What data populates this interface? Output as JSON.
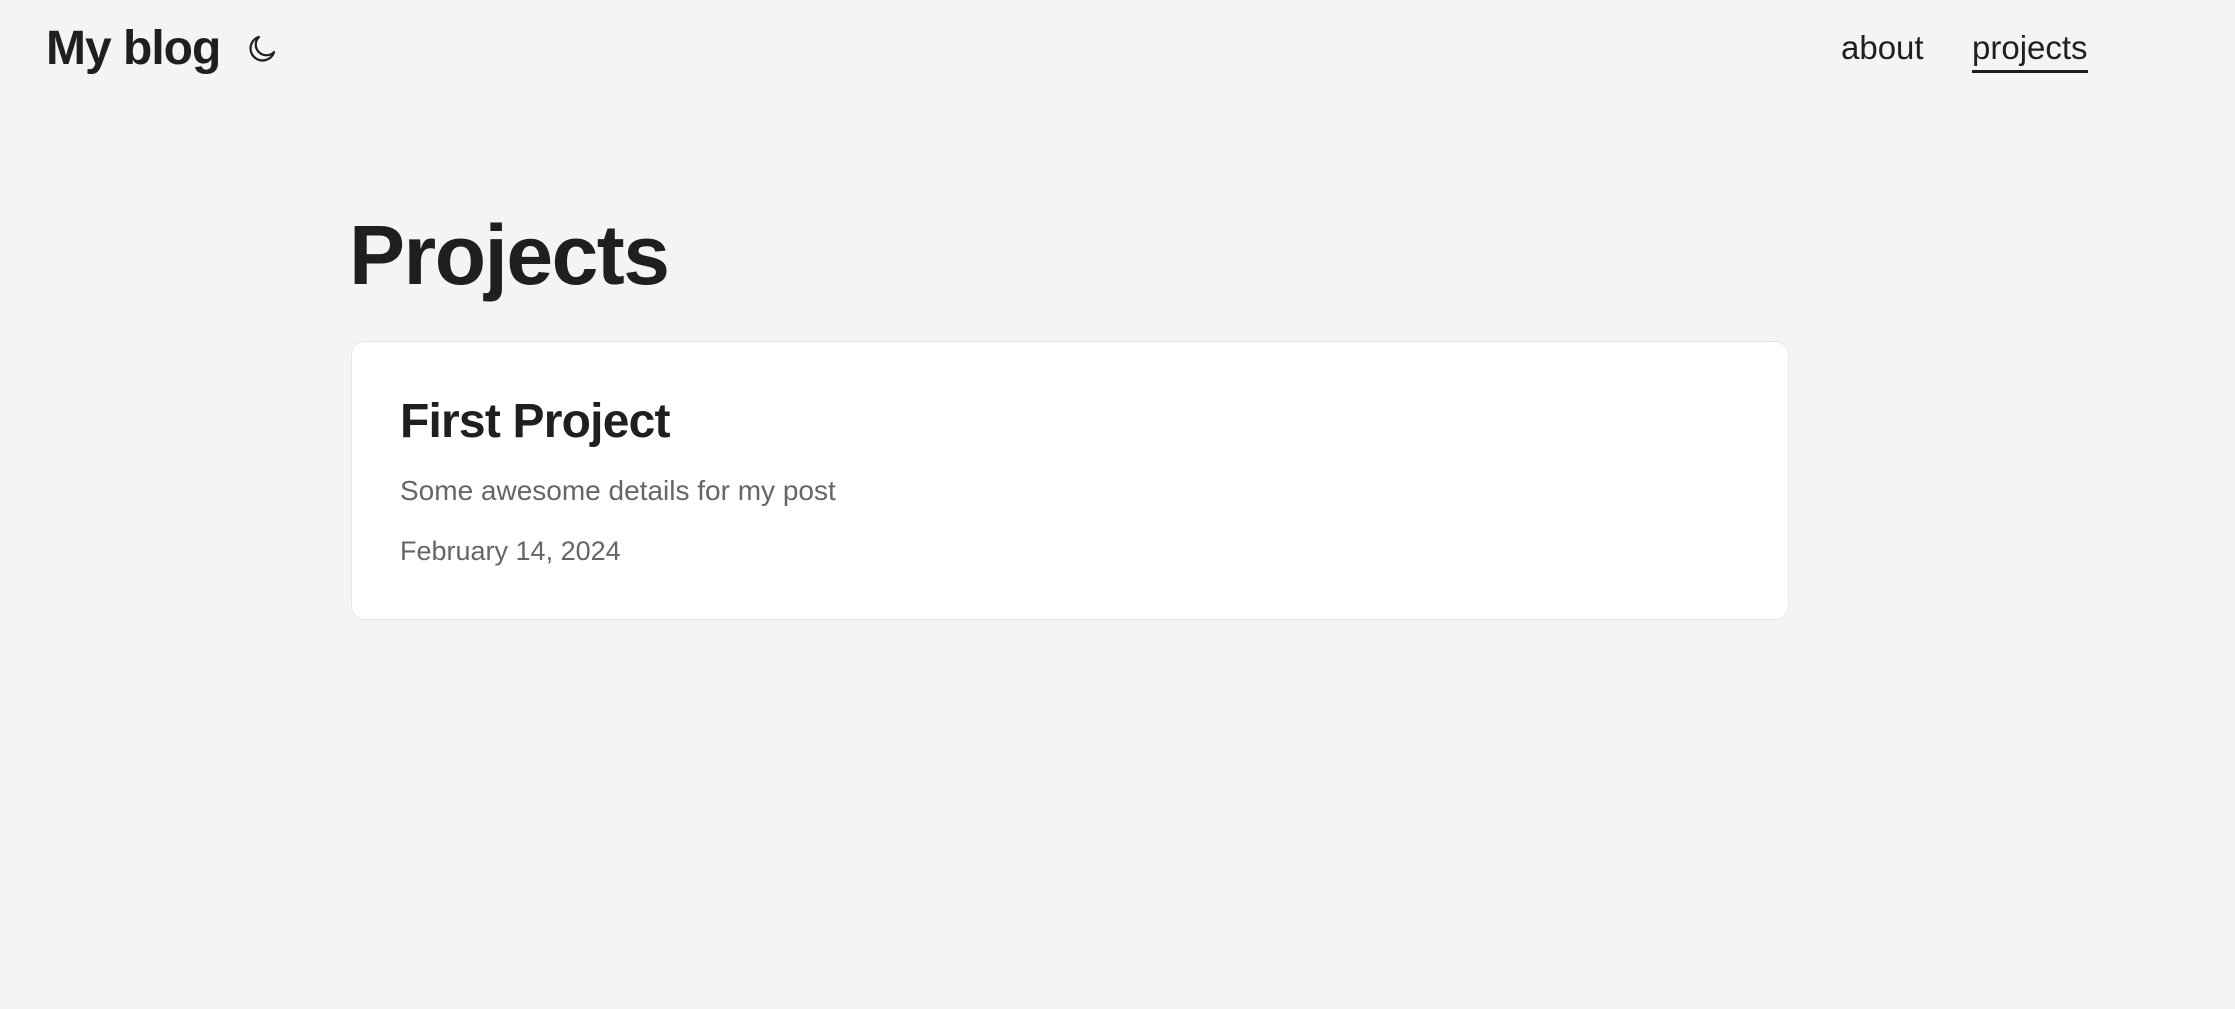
{
  "header": {
    "site_title": "My blog",
    "theme_toggle_icon": "moon-icon",
    "nav": [
      {
        "label": "about",
        "active": false
      },
      {
        "label": "projects",
        "active": true
      }
    ]
  },
  "main": {
    "page_title": "Projects",
    "projects": [
      {
        "title": "First Project",
        "description": "Some awesome details for my post",
        "date": "February 14, 2024"
      }
    ]
  },
  "colors": {
    "background": "#f4f4f4",
    "text": "#1f1f1f",
    "muted_text": "#666666",
    "card_background": "#ffffff",
    "card_border": "#e6e6e6"
  }
}
